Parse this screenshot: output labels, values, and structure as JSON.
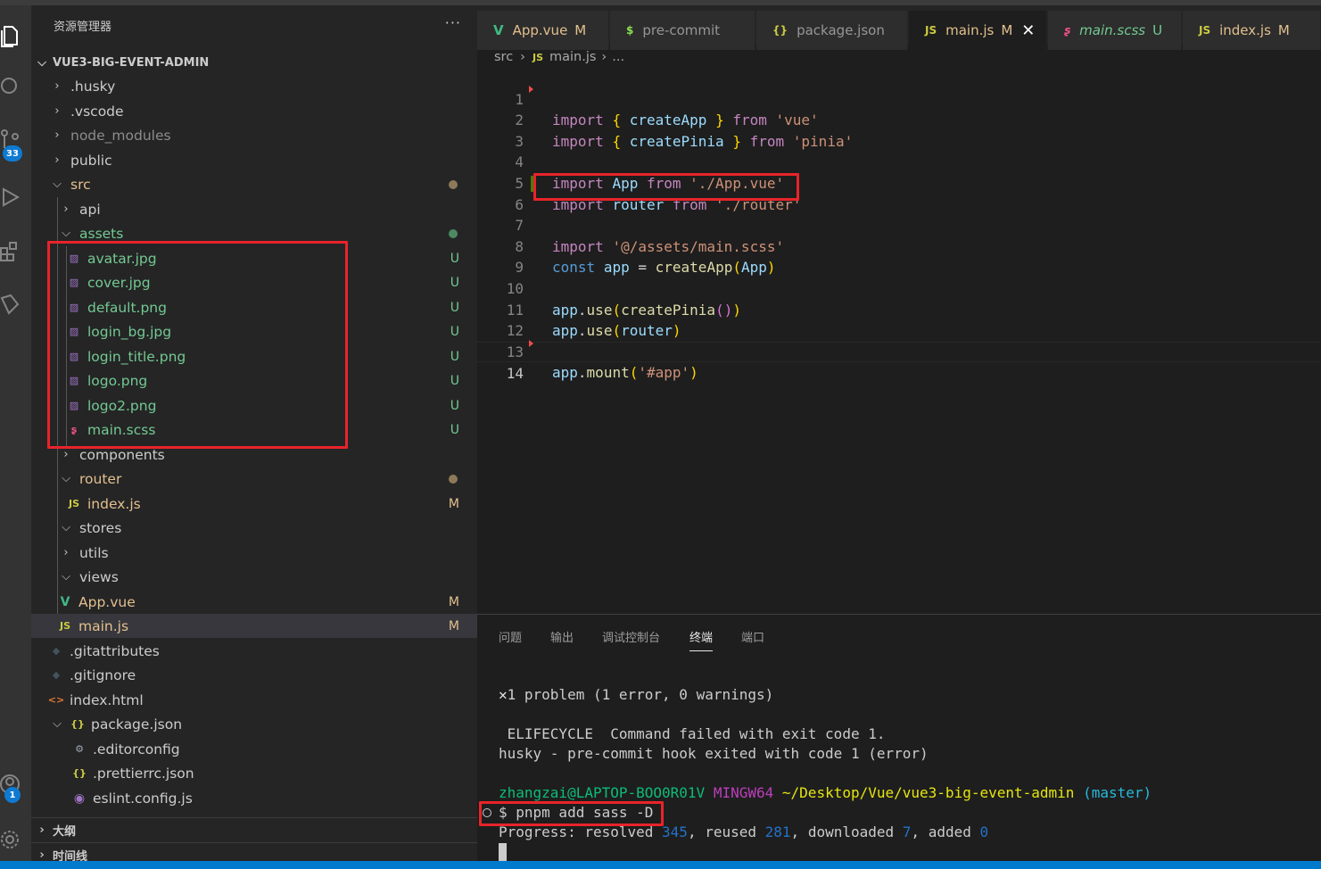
{
  "sidebar": {
    "title": "资源管理器",
    "more": "···",
    "project": "VUE3-BIG-EVENT-ADMIN",
    "activity_badge_scm": "33",
    "activity_badge_account": "1",
    "items": [
      {
        "label": ".husky"
      },
      {
        "label": ".vscode"
      },
      {
        "label": "node_modules"
      },
      {
        "label": "public"
      },
      {
        "label": "src"
      },
      {
        "label": "api"
      },
      {
        "label": "assets"
      },
      {
        "label": "avatar.jpg",
        "status": "U"
      },
      {
        "label": "cover.jpg",
        "status": "U"
      },
      {
        "label": "default.png",
        "status": "U"
      },
      {
        "label": "login_bg.jpg",
        "status": "U"
      },
      {
        "label": "login_title.png",
        "status": "U"
      },
      {
        "label": "logo.png",
        "status": "U"
      },
      {
        "label": "logo2.png",
        "status": "U"
      },
      {
        "label": "main.scss",
        "status": "U"
      },
      {
        "label": "components"
      },
      {
        "label": "router"
      },
      {
        "label": "index.js",
        "status": "M"
      },
      {
        "label": "stores"
      },
      {
        "label": "utils"
      },
      {
        "label": "views"
      },
      {
        "label": "App.vue",
        "status": "M"
      },
      {
        "label": "main.js",
        "status": "M"
      },
      {
        "label": ".gitattributes"
      },
      {
        "label": ".gitignore"
      },
      {
        "label": "index.html"
      },
      {
        "label": "package.json"
      },
      {
        "label": ".editorconfig"
      },
      {
        "label": ".prettierrc.json"
      },
      {
        "label": "eslint.config.js"
      }
    ],
    "outline": "大纲",
    "timeline": "时间线"
  },
  "tabs": [
    {
      "label": "App.vue",
      "status": "M"
    },
    {
      "label": "pre-commit",
      "status": ""
    },
    {
      "label": "package.json",
      "status": ""
    },
    {
      "label": "main.js",
      "status": "M"
    },
    {
      "label": "main.scss",
      "status": "U"
    },
    {
      "label": "index.js",
      "status": "M"
    }
  ],
  "breadcrumb": {
    "folder": "src",
    "file": "main.js",
    "rest": "..."
  },
  "code": {
    "line_numbers": [
      "1",
      "2",
      "3",
      "4",
      "5",
      "6",
      "7",
      "8",
      "9",
      "10",
      "11",
      "12",
      "13",
      "14"
    ],
    "l1": {
      "import": "import",
      "ob": "{",
      "name": "createApp",
      "cb": "}",
      "from": "from",
      "src": "'vue'"
    },
    "l2": {
      "import": "import",
      "ob": "{",
      "name": "createPinia",
      "cb": "}",
      "from": "from",
      "src": "'pinia'"
    },
    "l4": {
      "import": "import",
      "name": "App",
      "from": "from",
      "src": "'./App.vue'"
    },
    "l5": {
      "import": "import",
      "name": "router",
      "from": "from",
      "src": "'./router'"
    },
    "l6": {
      "import": "import",
      "src": "'@/assets/main.scss'"
    },
    "l8": {
      "const": "const",
      "name": "app",
      "eq": "=",
      "fn": "createApp",
      "op": "(",
      "arg": "App",
      "cp": ")"
    },
    "l10": {
      "obj": "app",
      "dot": ".",
      "fn": "use",
      "op": "(",
      "inner": "createPinia",
      "iop": "()",
      "cp": ")"
    },
    "l11": {
      "obj": "app",
      "dot": ".",
      "fn": "use",
      "op": "(",
      "arg": "router",
      "cp": ")"
    },
    "l13": {
      "obj": "app",
      "dot": ".",
      "fn": "mount",
      "op": "(",
      "arg": "'#app'",
      "cp": ")"
    }
  },
  "panel": {
    "tabs": [
      "问题",
      "输出",
      "调试控制台",
      "终端",
      "端口"
    ],
    "problem_icon": "✕",
    "problem_text": "1 problem (1 error, 0 warnings)",
    "elifecycle": " ELIFECYCLE  Command failed with exit code 1.",
    "husky": "husky - pre-commit hook exited with code 1 (error)",
    "prompt_user": "zhangzai@LAPTOP-BOO0R01V",
    "prompt_env": "MINGW64",
    "prompt_path": "~/Desktop/Vue/vue3-big-event-admin",
    "prompt_branch": "(master)",
    "command": "$ pnpm add sass -D",
    "progress_label": "Progress: resolved ",
    "resolved": "345",
    "reused_label": ", reused ",
    "reused": "281",
    "downloaded_label": ", downloaded ",
    "downloaded": "7",
    "added_label": ", added ",
    "added": "0"
  },
  "colors": {
    "accent": "#007acc",
    "highlight_box": "#e8242a",
    "untracked": "#73c991",
    "modified": "#e2c08d"
  }
}
